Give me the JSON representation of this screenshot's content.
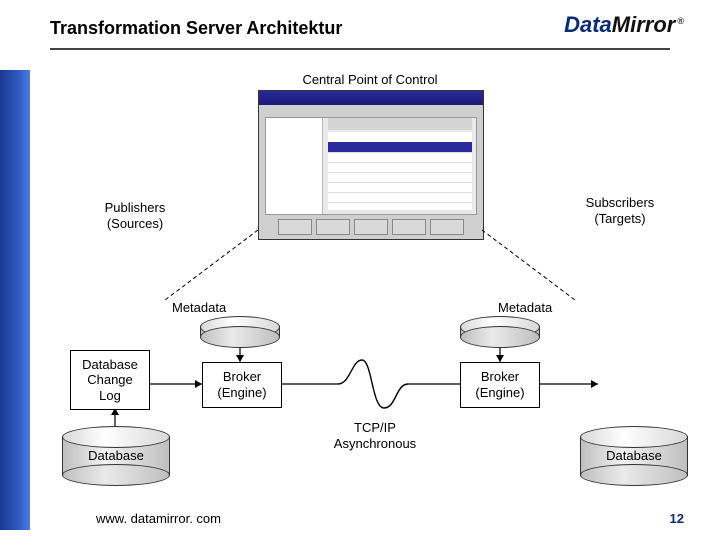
{
  "header": {
    "title": "Transformation Server Architektur",
    "logo_primary": "Data",
    "logo_secondary": "Mirror",
    "logo_mark": "®"
  },
  "captions": {
    "central": "Central Point of Control",
    "publishers_l1": "Publishers",
    "publishers_l2": "(Sources)",
    "subscribers_l1": "Subscribers",
    "subscribers_l2": "(Targets)",
    "metadata_left": "Metadata",
    "metadata_right": "Metadata",
    "tcpip_l1": "TCP/IP",
    "tcpip_l2": "Asynchronous"
  },
  "boxes": {
    "change_log_l1": "Database",
    "change_log_l2": "Change",
    "change_log_l3": "Log",
    "broker_left_l1": "Broker",
    "broker_left_l2": "(Engine)",
    "broker_right_l1": "Broker",
    "broker_right_l2": "(Engine)"
  },
  "cylinders": {
    "db_left": "Database",
    "db_right": "Database"
  },
  "footer": {
    "url": "www. datamirror. com",
    "page": "12"
  }
}
